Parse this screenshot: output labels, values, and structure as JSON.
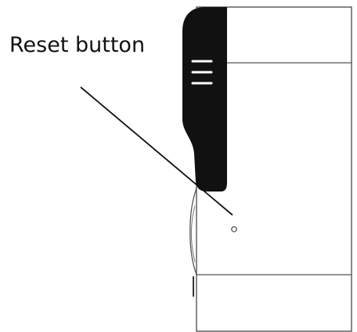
{
  "callout": {
    "label": "Reset button"
  },
  "colors": {
    "outline": "#555555",
    "casing_dark": "#111111",
    "leader_line": "#111111",
    "background": "#ffffff"
  },
  "icons": {
    "reset_hole": "small-circle",
    "grip_lines": "three-horizontal-lines"
  }
}
